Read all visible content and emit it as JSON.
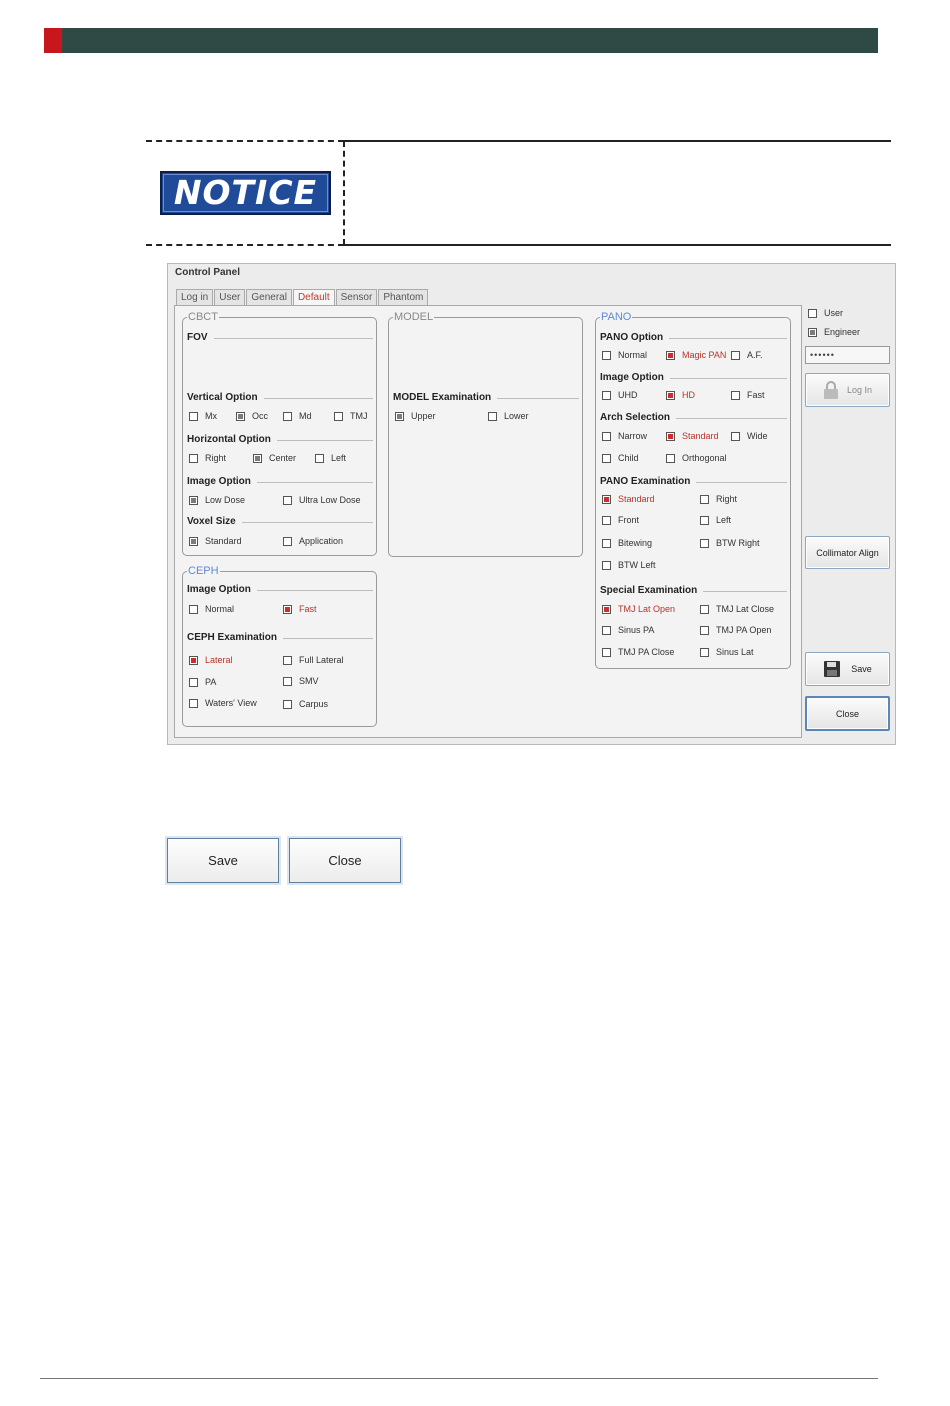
{
  "notice": {
    "badge": "NOTICE"
  },
  "window": {
    "title": "Control Panel",
    "tabs": [
      "Log in",
      "User",
      "General",
      "Default",
      "Sensor",
      "Phantom"
    ],
    "active_tab": "Default"
  },
  "cbct": {
    "legend": "CBCT",
    "fov_label": "FOV",
    "vertical_label": "Vertical Option",
    "vertical": [
      "Mx",
      "Occ",
      "Md",
      "TMJ"
    ],
    "horizontal_label": "Horizontal Option",
    "horizontal": [
      "Right",
      "Center",
      "Left"
    ],
    "image_label": "Image Option",
    "image": [
      "Low Dose",
      "Ultra Low Dose"
    ],
    "voxel_label": "Voxel Size",
    "voxel": [
      "Standard",
      "Application"
    ]
  },
  "ceph": {
    "legend": "CEPH",
    "image_label": "Image Option",
    "image": [
      "Normal",
      "Fast"
    ],
    "exam_label": "CEPH Examination",
    "exam": [
      "Lateral",
      "Full Lateral",
      "PA",
      "SMV",
      "Waters' View",
      "Carpus"
    ]
  },
  "model": {
    "legend": "MODEL",
    "exam_label": "MODEL Examination",
    "exam": [
      "Upper",
      "Lower"
    ]
  },
  "pano": {
    "legend": "PANO",
    "option_label": "PANO Option",
    "option": [
      "Normal",
      "Magic PAN",
      "A.F."
    ],
    "image_label": "Image Option",
    "image": [
      "UHD",
      "HD",
      "Fast"
    ],
    "arch_label": "Arch Selection",
    "arch": [
      "Narrow",
      "Standard",
      "Wide",
      "Child",
      "Orthogonal"
    ],
    "exam_label": "PANO Examination",
    "exam": [
      "Standard",
      "Right",
      "Front",
      "Left",
      "Bitewing",
      "BTW Right",
      "BTW Left"
    ],
    "special_label": "Special Examination",
    "special": [
      "TMJ Lat Open",
      "TMJ Lat Close",
      "Sinus PA",
      "TMJ PA Open",
      "TMJ PA Close",
      "Sinus Lat"
    ]
  },
  "side": {
    "user": "User",
    "engineer": "Engineer",
    "password": "••••••",
    "login": "Log In",
    "collimator": "Collimator Align",
    "save": "Save",
    "close": "Close"
  },
  "bottom_buttons": {
    "save": "Save",
    "close": "Close"
  },
  "colors": {
    "header": "#2f4a45",
    "accent": "#c8161d",
    "notice": "#1f4b99",
    "checked_red": "#d42a2a"
  }
}
